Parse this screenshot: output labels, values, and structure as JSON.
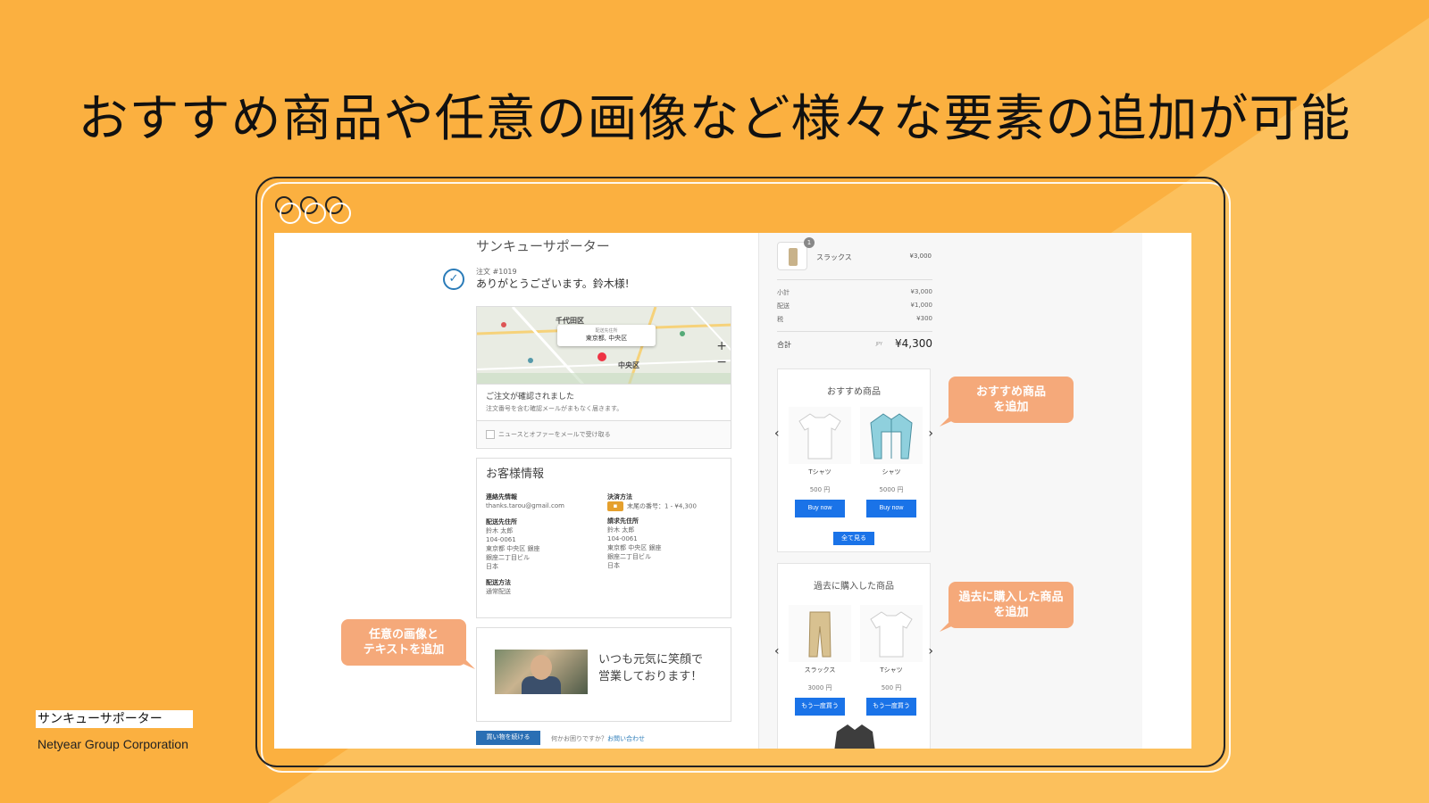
{
  "slide": {
    "headline": "おすすめ商品や任意の画像など様々な要素の追加が可能",
    "footer_company_jp": "サンキューサポーター",
    "footer_company_en": "Netyear Group Corporation",
    "colors": {
      "background": "#fbb040",
      "callout": "#f5a97a",
      "button_blue": "#1a73e8"
    }
  },
  "thankyou_page": {
    "store_name": "サンキューサポーター",
    "order_number": "注文 #1019",
    "thanks_message": "ありがとうございます。鈴木様!",
    "map": {
      "area_top": "千代田区",
      "area_bottom": "中央区",
      "label_title": "配送先住所",
      "label_address": "東京都, 中央区",
      "zoom_in": "+",
      "zoom_out": "−"
    },
    "confirmation": {
      "title": "ご注文が確認されました",
      "subtitle": "注文番号を含む確認メールがまもなく届きます。",
      "newsletter_label": "ニュースとオファーをメールで受け取る"
    },
    "customer": {
      "title": "お客様情報",
      "contact_label": "連絡先情報",
      "contact_value": "thanks.tarou@gmail.com",
      "payment_label": "決済方法",
      "payment_value": "末尾の番号：1 - ¥4,300",
      "shipping_label": "配送先住所",
      "shipping_lines": [
        "鈴木 太郎",
        "104-0061",
        "東京都 中央区 銀座",
        "銀座二丁目ビル",
        "日本"
      ],
      "billing_label": "請求先住所",
      "billing_lines": [
        "鈴木 太郎",
        "104-0061",
        "東京都 中央区 銀座",
        "銀座二丁目ビル",
        "日本"
      ],
      "method_label": "配送方法",
      "method_value": "通常配送"
    },
    "promo_text_line1": "いつも元気に笑顔で",
    "promo_text_line2": "営業しております！",
    "continue_button": "買い物を続ける",
    "help_text": "何かお困りですか？",
    "help_link": "お問い合わせ"
  },
  "sidebar": {
    "cart_item": {
      "name": "スラックス",
      "price": "¥3,000",
      "qty": "1"
    },
    "summary": [
      {
        "label": "小計",
        "value": "¥3,000"
      },
      {
        "label": "配送",
        "value": "¥1,000"
      },
      {
        "label": "税",
        "value": "¥300"
      }
    ],
    "total_label": "合計",
    "total_currency": "JPY",
    "total_value": "¥4,300",
    "recommended": {
      "title": "おすすめ商品",
      "products": [
        {
          "name": "Tシャツ",
          "price": "500 円",
          "button": "Buy now",
          "icon": "tshirt-icon"
        },
        {
          "name": "シャツ",
          "price": "5000 円",
          "button": "Buy now",
          "icon": "shirt-icon"
        }
      ],
      "see_all": "全て見る"
    },
    "past": {
      "title": "過去に購入した商品",
      "products": [
        {
          "name": "スラックス",
          "price": "3000 円",
          "button": "もう一度買う",
          "icon": "pants-icon"
        },
        {
          "name": "Tシャツ",
          "price": "500 円",
          "button": "もう一度買う",
          "icon": "tshirt-icon"
        }
      ]
    },
    "arrow_prev": "‹",
    "arrow_next": "›"
  },
  "callouts": {
    "recommended_l1": "おすすめ商品",
    "recommended_l2": "を追加",
    "past_l1": "過去に購入した商品",
    "past_l2": "を追加",
    "image_l1": "任意の画像と",
    "image_l2": "テキストを追加"
  }
}
